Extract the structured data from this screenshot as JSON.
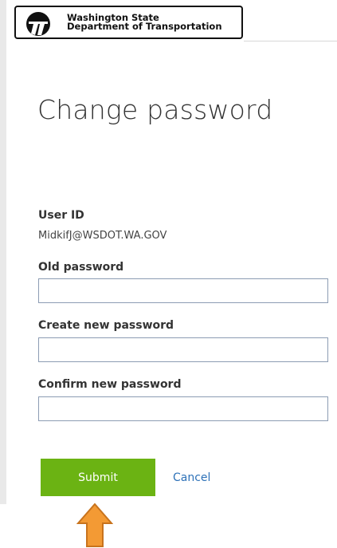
{
  "header": {
    "org_line1": "Washington State",
    "org_line2": "Department of Transportation",
    "logo_icon": "wsdot-logo-icon"
  },
  "form": {
    "title": "Change password",
    "user_id_label": "User ID",
    "user_id_value": "MidkifJ@WSDOT.WA.GOV",
    "old_password_label": "Old password",
    "old_password_value": "",
    "new_password_label": "Create new password",
    "new_password_value": "",
    "confirm_password_label": "Confirm new password",
    "confirm_password_value": ""
  },
  "actions": {
    "submit_label": "Submit",
    "cancel_label": "Cancel"
  },
  "annotation": {
    "arrow_icon": "arrow-up-icon"
  },
  "colors": {
    "submit_green": "#6bb313",
    "link_blue": "#2e72b8",
    "arrow_orange": "#f39a34"
  }
}
